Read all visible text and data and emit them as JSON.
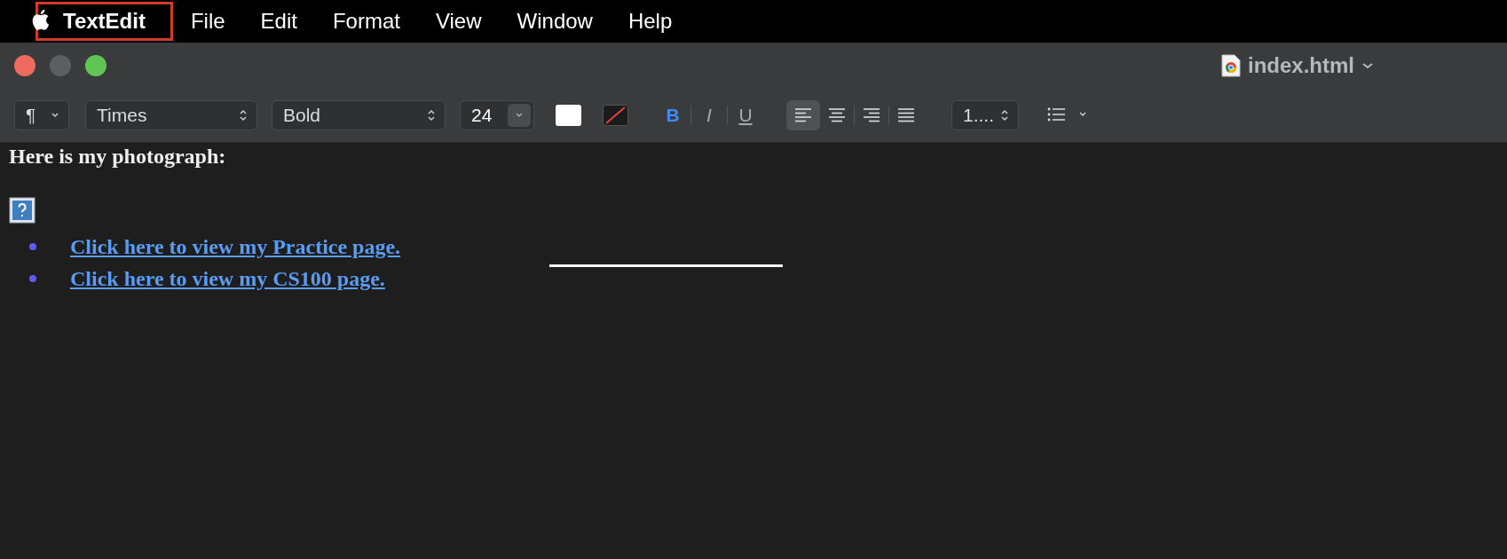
{
  "menu_bar": {
    "items": [
      {
        "label": "TextEdit",
        "app": true,
        "boxed": true
      },
      {
        "label": "File",
        "app": false,
        "boxed": false
      },
      {
        "label": "Edit",
        "app": false,
        "boxed": false
      },
      {
        "label": "Format",
        "app": false,
        "boxed": false
      },
      {
        "label": "View",
        "app": false,
        "boxed": false
      },
      {
        "label": "Window",
        "app": false,
        "boxed": false
      },
      {
        "label": "Help",
        "app": false,
        "boxed": false
      }
    ]
  },
  "window": {
    "title": "index.html"
  },
  "toolbar": {
    "paragraph_style": "¶",
    "font": "Times",
    "typeface": "Bold",
    "size": "24",
    "line_spacing": "1....",
    "styles": [
      {
        "label": "B",
        "kind": "bold",
        "on": true
      },
      {
        "label": "I",
        "kind": "italic",
        "on": false
      },
      {
        "label": "U",
        "kind": "underline",
        "on": false
      }
    ],
    "alignments": [
      {
        "kind": "left",
        "selected": true
      },
      {
        "kind": "center",
        "selected": false
      },
      {
        "kind": "right",
        "selected": false
      },
      {
        "kind": "justify",
        "selected": false
      }
    ]
  },
  "document": {
    "heading": "Here is my photograph:",
    "links": [
      "Click here to view my Practice page.",
      "Click here to view my CS100 page."
    ]
  }
}
